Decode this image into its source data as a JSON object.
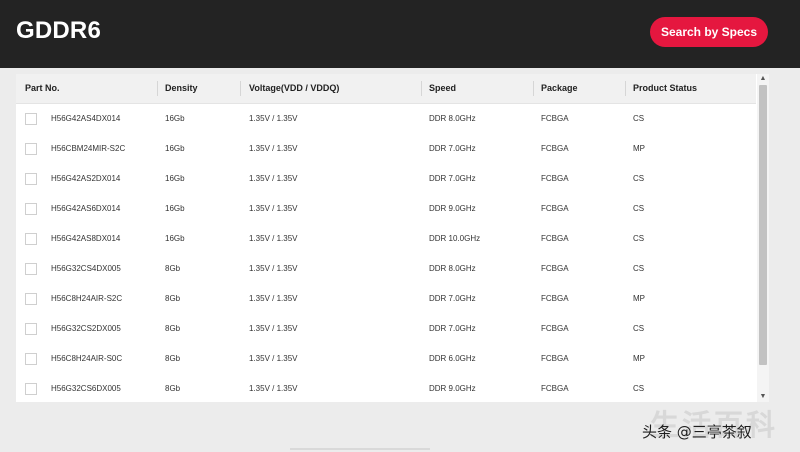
{
  "header": {
    "title": "GDDR6",
    "search_button": "Search by Specs"
  },
  "colors": {
    "header_bg": "#232323",
    "accent": "#e5173f"
  },
  "table": {
    "columns": [
      "Part No.",
      "Density",
      "Voltage(VDD / VDDQ)",
      "Speed",
      "Package",
      "Product Status"
    ],
    "rows": [
      {
        "part_no": "H56G42AS4DX014",
        "density": "16Gb",
        "voltage": "1.35V / 1.35V",
        "speed": "DDR 8.0GHz",
        "package": "FCBGA",
        "status": "CS"
      },
      {
        "part_no": "H56CBM24MIR-S2C",
        "density": "16Gb",
        "voltage": "1.35V / 1.35V",
        "speed": "DDR 7.0GHz",
        "package": "FCBGA",
        "status": "MP"
      },
      {
        "part_no": "H56G42AS2DX014",
        "density": "16Gb",
        "voltage": "1.35V / 1.35V",
        "speed": "DDR 7.0GHz",
        "package": "FCBGA",
        "status": "CS"
      },
      {
        "part_no": "H56G42AS6DX014",
        "density": "16Gb",
        "voltage": "1.35V / 1.35V",
        "speed": "DDR 9.0GHz",
        "package": "FCBGA",
        "status": "CS"
      },
      {
        "part_no": "H56G42AS8DX014",
        "density": "16Gb",
        "voltage": "1.35V / 1.35V",
        "speed": "DDR 10.0GHz",
        "package": "FCBGA",
        "status": "CS"
      },
      {
        "part_no": "H56G32CS4DX005",
        "density": "8Gb",
        "voltage": "1.35V / 1.35V",
        "speed": "DDR 8.0GHz",
        "package": "FCBGA",
        "status": "CS"
      },
      {
        "part_no": "H56C8H24AIR-S2C",
        "density": "8Gb",
        "voltage": "1.35V / 1.35V",
        "speed": "DDR 7.0GHz",
        "package": "FCBGA",
        "status": "MP"
      },
      {
        "part_no": "H56G32CS2DX005",
        "density": "8Gb",
        "voltage": "1.35V / 1.35V",
        "speed": "DDR 7.0GHz",
        "package": "FCBGA",
        "status": "CS"
      },
      {
        "part_no": "H56C8H24AIR-S0C",
        "density": "8Gb",
        "voltage": "1.35V / 1.35V",
        "speed": "DDR 6.0GHz",
        "package": "FCBGA",
        "status": "MP"
      },
      {
        "part_no": "H56G32CS6DX005",
        "density": "8Gb",
        "voltage": "1.35V / 1.35V",
        "speed": "DDR 9.0GHz",
        "package": "FCBGA",
        "status": "CS"
      }
    ]
  },
  "scrollbar": {
    "up_icon": "chevron-up-icon",
    "down_icon": "chevron-down-icon"
  },
  "watermark": {
    "background_text": "生活百科",
    "text": "头条 @三亭茶叙"
  }
}
